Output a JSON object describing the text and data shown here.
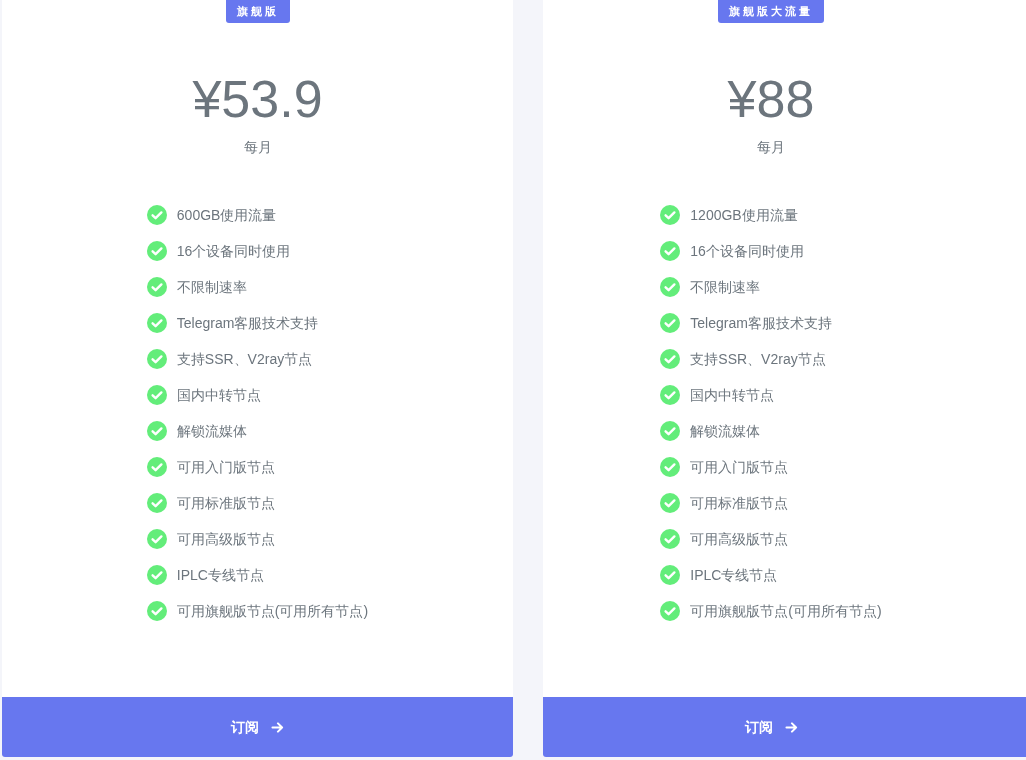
{
  "plans": [
    {
      "badge": "旗舰版",
      "price": "¥53.9",
      "period": "每月",
      "features": [
        "600GB使用流量",
        "16个设备同时使用",
        "不限制速率",
        "Telegram客服技术支持",
        "支持SSR、V2ray节点",
        "国内中转节点",
        "解锁流媒体",
        "可用入门版节点",
        "可用标准版节点",
        "可用高级版节点",
        "IPLC专线节点",
        "可用旗舰版节点(可用所有节点)"
      ],
      "button": {
        "label": "订阅"
      }
    },
    {
      "badge": "旗舰版大流量",
      "price": "¥88",
      "period": "每月",
      "features": [
        "1200GB使用流量",
        "16个设备同时使用",
        "不限制速率",
        "Telegram客服技术支持",
        "支持SSR、V2ray节点",
        "国内中转节点",
        "解锁流媒体",
        "可用入门版节点",
        "可用标准版节点",
        "可用高级版节点",
        "IPLC专线节点",
        "可用旗舰版节点(可用所有节点)"
      ],
      "button": {
        "label": "订阅"
      }
    }
  ]
}
